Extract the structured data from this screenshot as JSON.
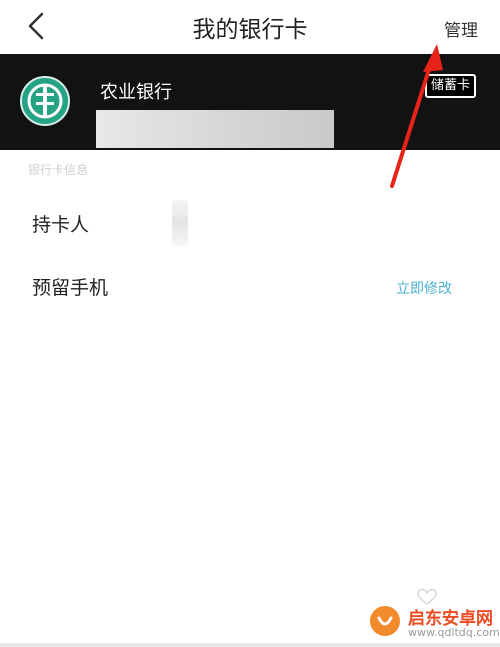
{
  "nav": {
    "title": "我的银行卡",
    "manage_label": "管理"
  },
  "card": {
    "bank_name": "农业银行",
    "card_type": "储蓄卡",
    "colors": {
      "background": "#121212",
      "logo": "#26a285"
    }
  },
  "info": {
    "section_label": "银行卡信息",
    "rows": [
      {
        "label": "持卡人"
      },
      {
        "label": "预留手机",
        "action": "立即修改"
      }
    ]
  },
  "watermark": {
    "title": "启东安卓网",
    "url": "www.qdltdq.com"
  },
  "annotation": {
    "arrow_color": "#e8231a"
  }
}
